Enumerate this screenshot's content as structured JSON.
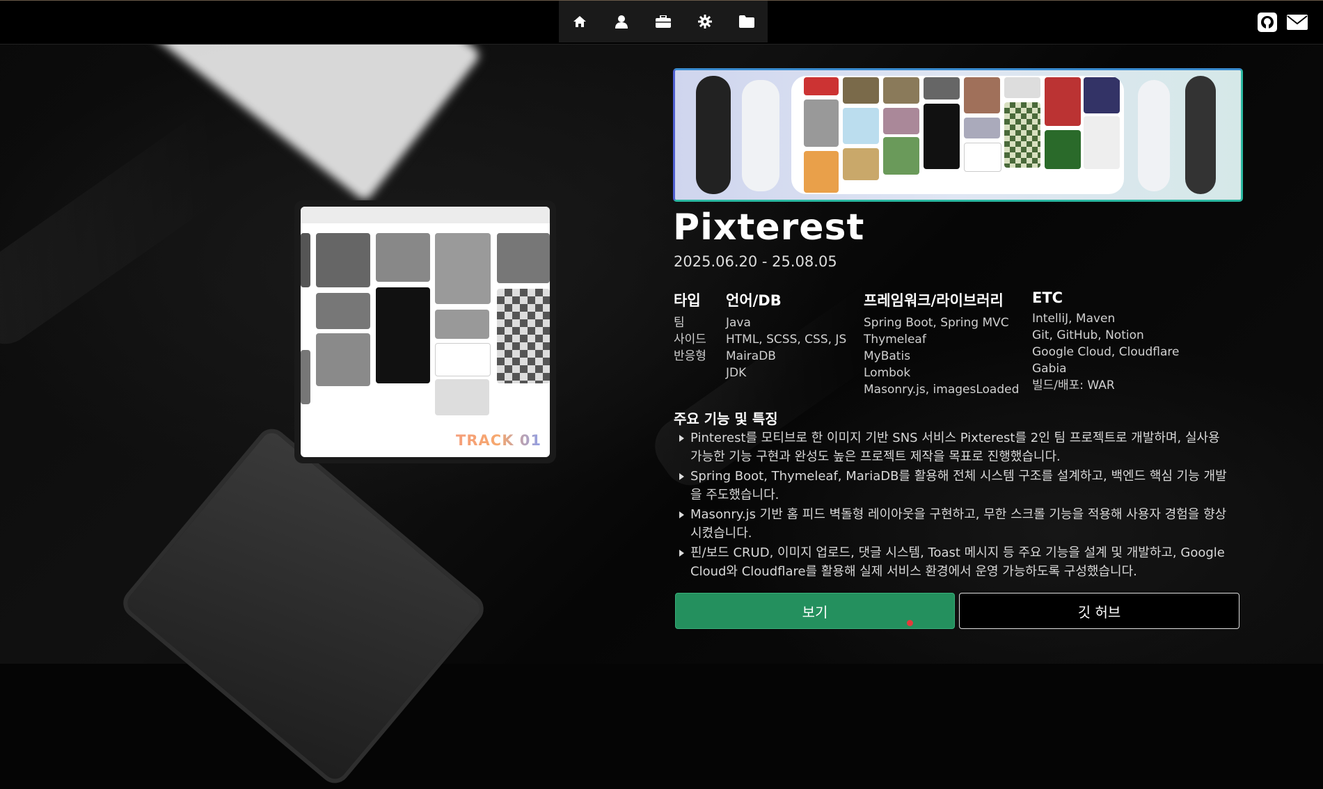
{
  "nav": {
    "icons": [
      "home-icon",
      "user-icon",
      "briefcase-icon",
      "gear-icon",
      "folder-icon"
    ],
    "right_icons": [
      "github-icon",
      "mail-icon"
    ]
  },
  "project": {
    "title": "Pixterest",
    "date": "2025.06.20 - 25.08.05",
    "track_label": "TRACK 01",
    "specs": [
      {
        "heading": "타입",
        "items": [
          "팀",
          "사이드",
          "반응형"
        ]
      },
      {
        "heading": "언어/DB",
        "items": [
          "Java",
          "HTML, SCSS, CSS, JS",
          "MairaDB",
          "JDK"
        ]
      },
      {
        "heading": "프레임워크/라이브러리",
        "items": [
          "Spring Boot, Spring MVC",
          "Thymeleaf",
          "MyBatis",
          "Lombok",
          "Masonry.js, imagesLoaded"
        ]
      },
      {
        "heading": "ETC",
        "items": [
          "IntelliJ, Maven",
          "Git, GitHub, Notion",
          "Google Cloud, Cloudflare",
          "Gabia",
          "빌드/배포: WAR"
        ]
      }
    ],
    "features_title": "주요 기능 및 특징",
    "features": [
      "Pinterest를 모티브로 한 이미지 기반 SNS 서비스 Pixterest를 2인 팀 프로젝트로 개발하며, 실사용 가능한 기능 구현과 완성도 높은 프로젝트 제작을 목표로 진행했습니다.",
      "Spring Boot, Thymeleaf, MariaDB를 활용해 전체 시스템 구조를 설계하고, 백엔드 핵심 기능 개발을 주도했습니다.",
      "Masonry.js 기반 홈 피드 벽돌형 레이아웃을 구현하고, 무한 스크롤 기능을 적용해 사용자 경험을 향상시켰습니다.",
      "핀/보드 CRUD, 이미지 업로드, 댓글 시스템, Toast 메시지 등 주요 기능을 설계 및 개발하고, Google Cloud와 Cloudflare를 활용해 실제 서비스 환경에서 운영 가능하도록 구성했습니다."
    ],
    "buttons": {
      "view": "보기",
      "github": "깃 허브"
    }
  },
  "colors": {
    "accent_green": "#24905e",
    "banner_border": "#2ab7a0"
  }
}
